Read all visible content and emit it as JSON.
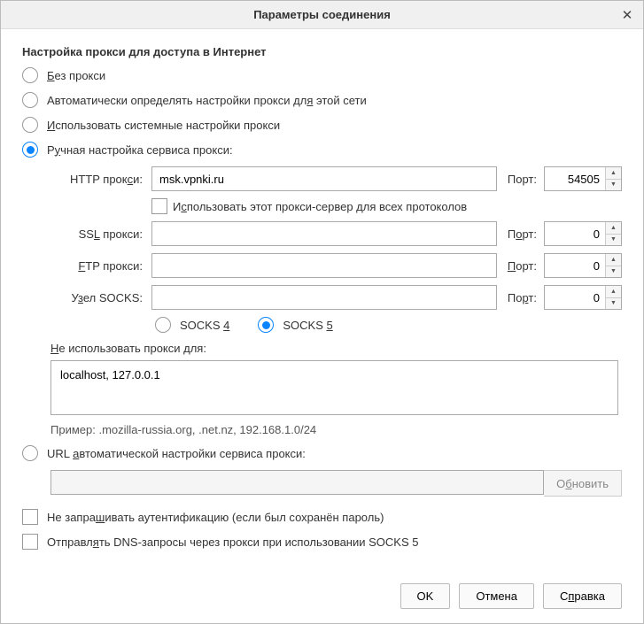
{
  "title": "Параметры соединения",
  "section_title": "Настройка прокси для доступа в Интернет",
  "radios": {
    "no_proxy": {
      "pre": "",
      "u": "Б",
      "post": "ез прокси"
    },
    "auto_detect": {
      "pre": "Автоматически определять настройки прокси дл",
      "u": "я",
      "post": " этой сети"
    },
    "system": {
      "pre": "",
      "u": "И",
      "post": "спользовать системные настройки прокси"
    },
    "manual": {
      "pre": "Р",
      "u": "у",
      "post": "чная настройка сервиса прокси:"
    },
    "pac": {
      "pre": "URL ",
      "u": "а",
      "post": "втоматической настройки сервиса прокси:"
    }
  },
  "http": {
    "label_pre": "HTTP прок",
    "label_u": "с",
    "label_post": "и:",
    "host": "msk.vpnki.ru",
    "port": "54505"
  },
  "use_for_all": {
    "pre": "И",
    "u": "с",
    "post": "пользовать этот прокси-сервер для всех протоколов"
  },
  "ssl": {
    "label_pre": "SS",
    "label_u": "L",
    "label_post": " прокси:",
    "host": "",
    "port": "0"
  },
  "ftp": {
    "label_pre": "",
    "label_u": "F",
    "label_post": "TP прокси:",
    "host": "",
    "port": "0"
  },
  "socks": {
    "label_pre": "У",
    "label_u": "з",
    "label_post": "ел SOCKS:",
    "host": "",
    "port": "0"
  },
  "port_label_http": "Порт:",
  "port_label_ssl": {
    "pre": "П",
    "u": "о",
    "post": "рт:"
  },
  "port_label_ftp": {
    "pre": "",
    "u": "П",
    "post": "орт:"
  },
  "port_label_socks": {
    "pre": "По",
    "u": "р",
    "post": "т:"
  },
  "socks4": {
    "pre": "SOCKS ",
    "u": "4",
    "post": ""
  },
  "socks5": {
    "pre": "SOCKS ",
    "u": "5",
    "post": ""
  },
  "noproxy_label": {
    "pre": "",
    "u": "Н",
    "post": "е использовать прокси для:"
  },
  "noproxy_value": "localhost, 127.0.0.1",
  "example": "Пример: .mozilla-russia.org, .net.nz, 192.168.1.0/24",
  "pac_url": "",
  "reload_btn": {
    "pre": "О",
    "u": "б",
    "post": "новить"
  },
  "no_auth": {
    "pre": "Не запра",
    "u": "ш",
    "post": "ивать аутентификацию (если был сохранён пароль)"
  },
  "dns_socks5": {
    "pre": "Отправл",
    "u": "я",
    "post": "ть DNS-запросы через прокси при использовании SOCKS 5"
  },
  "buttons": {
    "ok": "OK",
    "cancel": "Отмена",
    "help": {
      "pre": "С",
      "u": "п",
      "post": "равка"
    }
  }
}
